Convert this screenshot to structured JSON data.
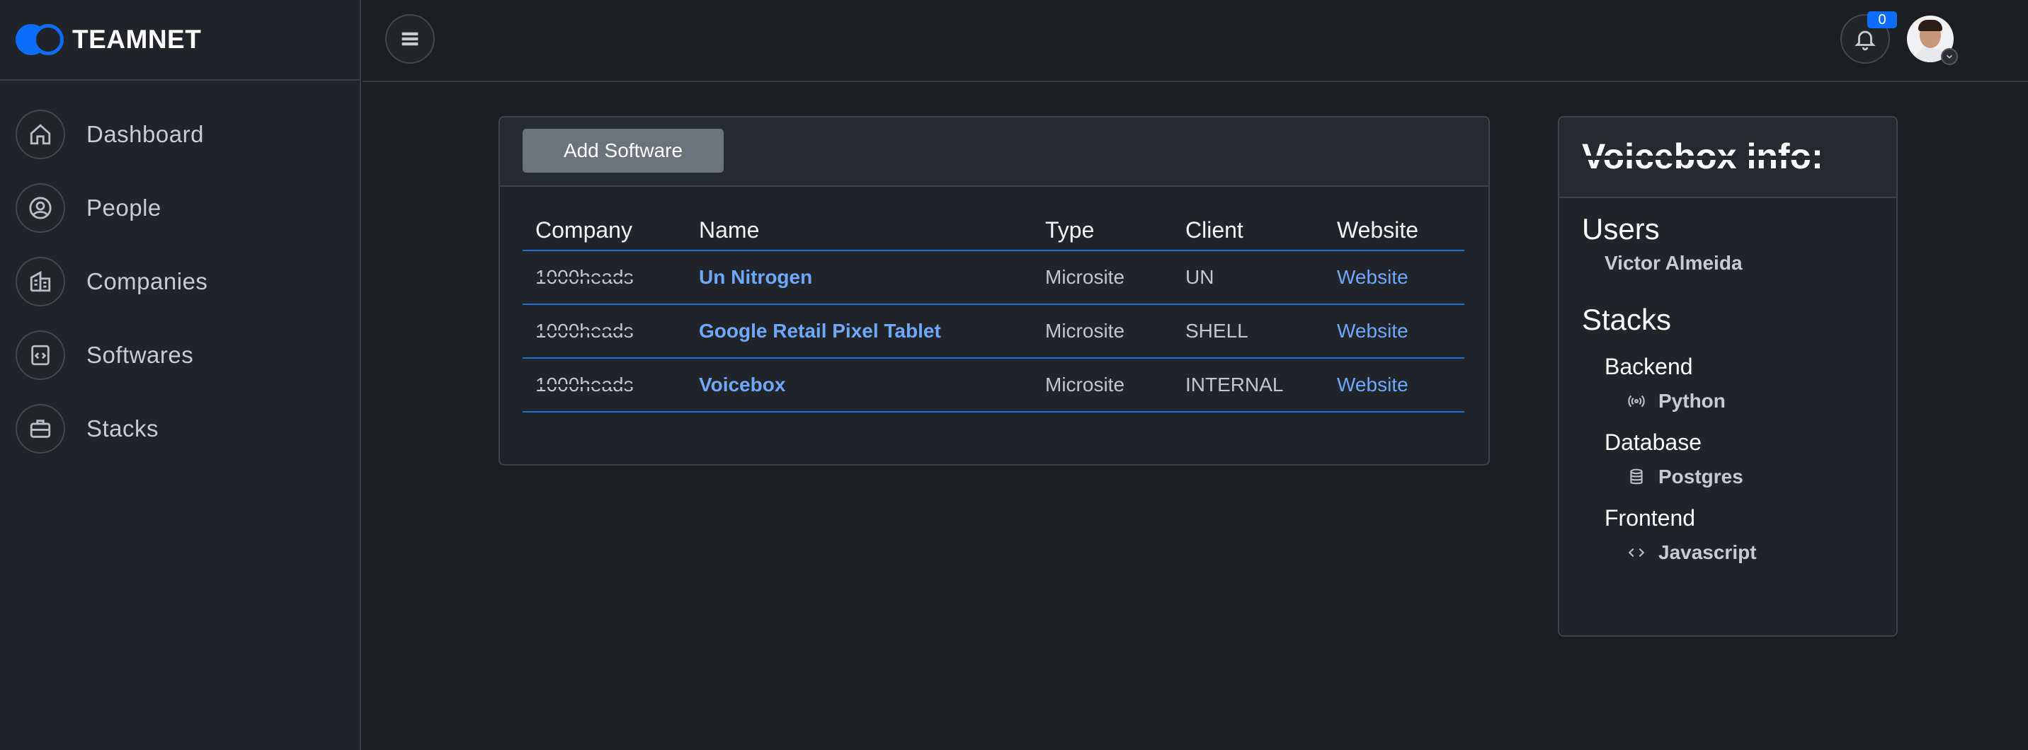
{
  "brand": {
    "name": "TEAMNET"
  },
  "sidebar": {
    "items": [
      {
        "label": "Dashboard",
        "icon": "home-icon"
      },
      {
        "label": "People",
        "icon": "person-circle-icon"
      },
      {
        "label": "Companies",
        "icon": "building-icon"
      },
      {
        "label": "Softwares",
        "icon": "file-code-icon"
      },
      {
        "label": "Stacks",
        "icon": "briefcase-icon"
      }
    ]
  },
  "topbar": {
    "notifications_count": "0"
  },
  "software": {
    "add_button_label": "Add Software",
    "columns": [
      "Company",
      "Name",
      "Type",
      "Client",
      "Website"
    ],
    "rows": [
      {
        "company": "1000heads",
        "name": "Un Nitrogen",
        "type": "Microsite",
        "client": "UN",
        "website": "Website"
      },
      {
        "company": "1000heads",
        "name": "Google Retail Pixel Tablet",
        "type": "Microsite",
        "client": "SHELL",
        "website": "Website"
      },
      {
        "company": "1000heads",
        "name": "Voicebox",
        "type": "Microsite",
        "client": "INTERNAL",
        "website": "Website"
      }
    ]
  },
  "info": {
    "title": "Voicebox info:",
    "users_heading": "Users",
    "users": [
      "Victor Almeida"
    ],
    "stacks_heading": "Stacks",
    "stacks": [
      {
        "category": "Backend",
        "tech": "Python",
        "icon": "broadcast-icon"
      },
      {
        "category": "Database",
        "tech": "Postgres",
        "icon": "database-icon"
      },
      {
        "category": "Frontend",
        "tech": "Javascript",
        "icon": "code-icon"
      }
    ]
  },
  "colors": {
    "accent": "#0d6efd",
    "link": "#6ea8fe",
    "background": "#1d1e22",
    "card": "#212429"
  }
}
